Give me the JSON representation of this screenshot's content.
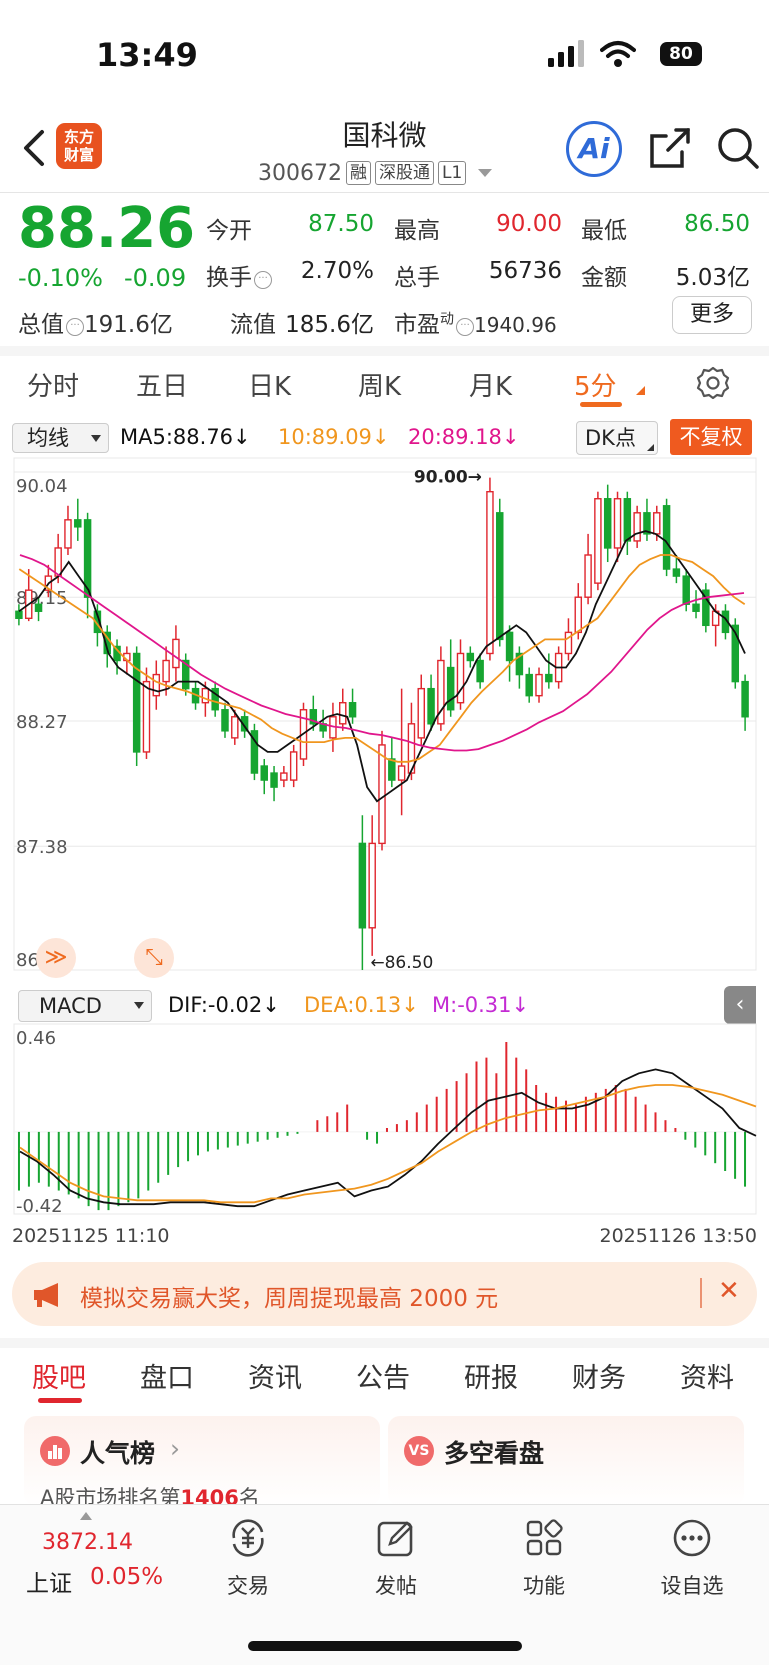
{
  "status": {
    "time": "13:49",
    "battery": "80"
  },
  "header": {
    "logo_line1": "东方",
    "logo_line2": "财富",
    "name": "国科微",
    "code": "300672",
    "tags": [
      "融",
      "深股通",
      "L1"
    ],
    "ai_label": "Ai"
  },
  "quote": {
    "price": "88.26",
    "change_pct": "-0.10%",
    "change": "-0.09",
    "rows": [
      [
        {
          "label": "今开",
          "value": "87.50",
          "color": "green"
        },
        {
          "label": "最高",
          "value": "90.00",
          "color": "red"
        },
        {
          "label": "最低",
          "value": "86.50",
          "color": "green"
        }
      ],
      [
        {
          "label": "换手",
          "value": "2.70%",
          "color": "dark",
          "info": true
        },
        {
          "label": "总手",
          "value": "56736",
          "color": "dark"
        },
        {
          "label": "金额",
          "value": "5.03亿",
          "color": "dark"
        }
      ],
      [
        {
          "label": "总值",
          "value": "191.6亿",
          "color": "dark",
          "info": true
        },
        {
          "label": "流值",
          "value": "185.6亿",
          "color": "dark"
        },
        {
          "label": "市盈",
          "sup": "动",
          "value": "1940.96",
          "color": "dark",
          "info": true
        }
      ]
    ],
    "more_label": "更多"
  },
  "period_tabs": [
    "分时",
    "五日",
    "日K",
    "周K",
    "月K",
    "5分"
  ],
  "active_period": "5分",
  "ma_legend": {
    "selector": "均线",
    "ma5": "MA5:88.76↓",
    "ma10": "10:89.09↓",
    "ma20": "20:89.18↓",
    "dk": "DK点",
    "adjust": "不复权"
  },
  "macd_legend": {
    "selector": "MACD",
    "dif": "DIF:-0.02↓",
    "dea": "DEA:0.13↓",
    "m": "M:-0.31↓"
  },
  "chart_data": {
    "type": "candlestick",
    "price_axis": {
      "ticks": [
        "90.04",
        "89.15",
        "88.27",
        "87.38",
        "86.50"
      ],
      "range": [
        86.5,
        90.04
      ]
    },
    "annotations": {
      "high": "90.00",
      "low": "86.50"
    },
    "candles": [
      {
        "o": 89.05,
        "c": 89.0,
        "h": 89.1,
        "l": 88.95
      },
      {
        "o": 89.0,
        "c": 89.2,
        "h": 89.35,
        "l": 88.98
      },
      {
        "o": 89.1,
        "c": 89.05,
        "h": 89.15,
        "l": 88.98
      },
      {
        "o": 89.2,
        "c": 89.3,
        "h": 89.38,
        "l": 89.15
      },
      {
        "o": 89.3,
        "c": 89.5,
        "h": 89.6,
        "l": 89.25
      },
      {
        "o": 89.5,
        "c": 89.7,
        "h": 89.8,
        "l": 89.45
      },
      {
        "o": 89.7,
        "c": 89.65,
        "h": 89.85,
        "l": 89.55
      },
      {
        "o": 89.7,
        "c": 89.15,
        "h": 89.75,
        "l": 89.0
      },
      {
        "o": 89.05,
        "c": 88.9,
        "h": 89.1,
        "l": 88.8
      },
      {
        "o": 88.9,
        "c": 88.75,
        "h": 88.95,
        "l": 88.65
      },
      {
        "o": 88.8,
        "c": 88.7,
        "h": 88.85,
        "l": 88.6
      },
      {
        "o": 88.7,
        "c": 88.75,
        "h": 88.8,
        "l": 88.6
      },
      {
        "o": 88.75,
        "c": 88.05,
        "h": 88.8,
        "l": 87.95
      },
      {
        "o": 88.05,
        "c": 88.55,
        "h": 88.65,
        "l": 88.0
      },
      {
        "o": 88.45,
        "c": 88.6,
        "h": 88.7,
        "l": 88.35
      },
      {
        "o": 88.55,
        "c": 88.7,
        "h": 88.8,
        "l": 88.45
      },
      {
        "o": 88.65,
        "c": 88.85,
        "h": 88.95,
        "l": 88.55
      },
      {
        "o": 88.7,
        "c": 88.5,
        "h": 88.75,
        "l": 88.45
      },
      {
        "o": 88.5,
        "c": 88.4,
        "h": 88.55,
        "l": 88.35
      },
      {
        "o": 88.4,
        "c": 88.5,
        "h": 88.55,
        "l": 88.3
      },
      {
        "o": 88.5,
        "c": 88.35,
        "h": 88.55,
        "l": 88.3
      },
      {
        "o": 88.35,
        "c": 88.2,
        "h": 88.4,
        "l": 88.15
      },
      {
        "o": 88.15,
        "c": 88.3,
        "h": 88.35,
        "l": 88.1
      },
      {
        "o": 88.3,
        "c": 88.2,
        "h": 88.35,
        "l": 88.15
      },
      {
        "o": 88.2,
        "c": 87.9,
        "h": 88.25,
        "l": 87.85
      },
      {
        "o": 87.95,
        "c": 87.85,
        "h": 88.0,
        "l": 87.75
      },
      {
        "o": 87.9,
        "c": 87.8,
        "h": 87.95,
        "l": 87.7
      },
      {
        "o": 87.85,
        "c": 87.9,
        "h": 87.95,
        "l": 87.8
      },
      {
        "o": 87.85,
        "c": 88.05,
        "h": 88.1,
        "l": 87.8
      },
      {
        "o": 88.0,
        "c": 88.35,
        "h": 88.4,
        "l": 87.95
      },
      {
        "o": 88.35,
        "c": 88.25,
        "h": 88.45,
        "l": 88.2
      },
      {
        "o": 88.25,
        "c": 88.2,
        "h": 88.35,
        "l": 88.15
      },
      {
        "o": 88.15,
        "c": 88.3,
        "h": 88.4,
        "l": 88.05
      },
      {
        "o": 88.25,
        "c": 88.4,
        "h": 88.5,
        "l": 88.2
      },
      {
        "o": 88.4,
        "c": 88.3,
        "h": 88.5,
        "l": 88.25
      },
      {
        "o": 87.4,
        "c": 86.8,
        "h": 87.6,
        "l": 86.5
      },
      {
        "o": 86.8,
        "c": 87.4,
        "h": 87.6,
        "l": 86.6
      },
      {
        "o": 87.4,
        "c": 88.1,
        "h": 88.2,
        "l": 87.35
      },
      {
        "o": 88.0,
        "c": 87.85,
        "h": 88.15,
        "l": 87.8
      },
      {
        "o": 87.85,
        "c": 87.95,
        "h": 88.5,
        "l": 87.6
      },
      {
        "o": 87.9,
        "c": 88.25,
        "h": 88.4,
        "l": 87.85
      },
      {
        "o": 88.15,
        "c": 88.5,
        "h": 88.6,
        "l": 88.1
      },
      {
        "o": 88.5,
        "c": 88.25,
        "h": 88.6,
        "l": 88.2
      },
      {
        "o": 88.25,
        "c": 88.7,
        "h": 88.8,
        "l": 88.2
      },
      {
        "o": 88.65,
        "c": 88.35,
        "h": 88.85,
        "l": 88.3
      },
      {
        "o": 88.4,
        "c": 88.75,
        "h": 88.85,
        "l": 88.35
      },
      {
        "o": 88.75,
        "c": 88.7,
        "h": 88.8,
        "l": 88.65
      },
      {
        "o": 88.7,
        "c": 88.55,
        "h": 88.75,
        "l": 88.5
      },
      {
        "o": 88.75,
        "c": 89.9,
        "h": 90.0,
        "l": 88.7
      },
      {
        "o": 89.75,
        "c": 88.85,
        "h": 89.85,
        "l": 88.8
      },
      {
        "o": 88.9,
        "c": 88.7,
        "h": 88.95,
        "l": 88.55
      },
      {
        "o": 88.75,
        "c": 88.6,
        "h": 88.8,
        "l": 88.5
      },
      {
        "o": 88.6,
        "c": 88.45,
        "h": 88.65,
        "l": 88.4
      },
      {
        "o": 88.45,
        "c": 88.6,
        "h": 88.65,
        "l": 88.4
      },
      {
        "o": 88.6,
        "c": 88.55,
        "h": 88.75,
        "l": 88.5
      },
      {
        "o": 88.55,
        "c": 88.75,
        "h": 88.8,
        "l": 88.5
      },
      {
        "o": 88.75,
        "c": 88.9,
        "h": 89.0,
        "l": 88.7
      },
      {
        "o": 88.9,
        "c": 89.15,
        "h": 89.25,
        "l": 88.85
      },
      {
        "o": 89.15,
        "c": 89.45,
        "h": 89.6,
        "l": 89.1
      },
      {
        "o": 89.25,
        "c": 89.85,
        "h": 89.9,
        "l": 89.2
      },
      {
        "o": 89.85,
        "c": 89.5,
        "h": 89.95,
        "l": 89.4
      },
      {
        "o": 89.5,
        "c": 89.85,
        "h": 89.9,
        "l": 89.4
      },
      {
        "o": 89.85,
        "c": 89.55,
        "h": 89.9,
        "l": 89.45
      },
      {
        "o": 89.55,
        "c": 89.75,
        "h": 89.8,
        "l": 89.5
      },
      {
        "o": 89.75,
        "c": 89.6,
        "h": 89.85,
        "l": 89.55
      },
      {
        "o": 89.6,
        "c": 89.75,
        "h": 89.8,
        "l": 89.55
      },
      {
        "o": 89.8,
        "c": 89.35,
        "h": 89.85,
        "l": 89.3
      },
      {
        "o": 89.35,
        "c": 89.3,
        "h": 89.45,
        "l": 89.25
      },
      {
        "o": 89.3,
        "c": 89.1,
        "h": 89.35,
        "l": 89.05
      },
      {
        "o": 89.1,
        "c": 89.05,
        "h": 89.2,
        "l": 89.0
      },
      {
        "o": 89.2,
        "c": 88.95,
        "h": 89.25,
        "l": 88.9
      },
      {
        "o": 88.95,
        "c": 89.05,
        "h": 89.1,
        "l": 88.8
      },
      {
        "o": 89.05,
        "c": 88.9,
        "h": 89.1,
        "l": 88.85
      },
      {
        "o": 88.95,
        "c": 88.55,
        "h": 89.0,
        "l": 88.5
      },
      {
        "o": 88.55,
        "c": 88.3,
        "h": 88.6,
        "l": 88.2
      }
    ],
    "ma": {
      "ma5": {
        "color": "#111111",
        "values": [
          89.05,
          89.1,
          89.15,
          89.25,
          89.3,
          89.4,
          89.3,
          89.2,
          89.0,
          88.75,
          88.65,
          88.6,
          88.55,
          88.5,
          88.48,
          88.5,
          88.55,
          88.55,
          88.55,
          88.5,
          88.45,
          88.4,
          88.3,
          88.2,
          88.1,
          88.05,
          88.05,
          88.1,
          88.15,
          88.2,
          88.25,
          88.3,
          88.32,
          88.3,
          88.1,
          87.8,
          87.7,
          87.75,
          87.8,
          87.85,
          88.0,
          88.15,
          88.3,
          88.4,
          88.45,
          88.55,
          88.7,
          88.8,
          88.85,
          88.9,
          88.95,
          88.9,
          88.8,
          88.7,
          88.65,
          88.65,
          88.75,
          88.9,
          89.1,
          89.25,
          89.4,
          89.55,
          89.6,
          89.62,
          89.6,
          89.55,
          89.45,
          89.35,
          89.25,
          89.15,
          89.05,
          89.0,
          88.9,
          88.75
        ]
      },
      "ma10": {
        "color": "#f0961e",
        "values": [
          89.35,
          89.3,
          89.25,
          89.2,
          89.15,
          89.1,
          89.05,
          89.0,
          88.9,
          88.8,
          88.72,
          88.65,
          88.6,
          88.55,
          88.52,
          88.5,
          88.48,
          88.45,
          88.42,
          88.4,
          88.38,
          88.36,
          88.32,
          88.28,
          88.22,
          88.18,
          88.15,
          88.12,
          88.12,
          88.12,
          88.14,
          88.15,
          88.15,
          88.1,
          88.05,
          88.0,
          87.98,
          87.98,
          88.0,
          88.05,
          88.1,
          88.2,
          88.3,
          88.4,
          88.48,
          88.55,
          88.62,
          88.7,
          88.75,
          88.8,
          88.85,
          88.85,
          88.85,
          88.9,
          88.95,
          89.0,
          89.1,
          89.2,
          89.3,
          89.38,
          89.42,
          89.45,
          89.45,
          89.42,
          89.4,
          89.35,
          89.3,
          89.22,
          89.15,
          89.1
        ]
      },
      "ma20": {
        "color": "#e0168c",
        "values": [
          89.45,
          89.42,
          89.38,
          89.32,
          89.26,
          89.2,
          89.14,
          89.08,
          89.02,
          88.96,
          88.9,
          88.84,
          88.78,
          88.72,
          88.66,
          88.6,
          88.55,
          88.5,
          88.46,
          88.42,
          88.38,
          88.35,
          88.32,
          88.3,
          88.28,
          88.25,
          88.23,
          88.22,
          88.2,
          88.18,
          88.17,
          88.15,
          88.13,
          88.1,
          88.08,
          88.07,
          88.06,
          88.06,
          88.07,
          88.1,
          88.13,
          88.17,
          88.21,
          88.26,
          88.3,
          88.34,
          88.4,
          88.46,
          88.54,
          88.62,
          88.72,
          88.82,
          88.92,
          89.0,
          89.06,
          89.1,
          89.13,
          89.15,
          89.16,
          89.17,
          89.18
        ]
      }
    },
    "macd": {
      "axis_ticks": [
        "0.46",
        "-0.42"
      ],
      "range": [
        -0.42,
        0.46
      ],
      "hist": [
        -0.3,
        -0.28,
        -0.26,
        -0.28,
        -0.3,
        -0.32,
        -0.34,
        -0.38,
        -0.4,
        -0.4,
        -0.38,
        -0.36,
        -0.34,
        -0.3,
        -0.26,
        -0.22,
        -0.18,
        -0.15,
        -0.12,
        -0.1,
        -0.09,
        -0.08,
        -0.07,
        -0.06,
        -0.05,
        -0.04,
        -0.03,
        -0.02,
        -0.01,
        0.0,
        0.06,
        0.08,
        0.1,
        0.14,
        0.0,
        -0.04,
        -0.06,
        0.02,
        0.04,
        0.06,
        0.1,
        0.14,
        0.18,
        0.22,
        0.26,
        0.3,
        0.36,
        0.38,
        0.3,
        0.46,
        0.38,
        0.32,
        0.24,
        0.2,
        0.18,
        0.16,
        0.14,
        0.18,
        0.2,
        0.22,
        0.24,
        0.22,
        0.18,
        0.14,
        0.1,
        0.06,
        0.02,
        -0.04,
        -0.08,
        -0.12,
        -0.16,
        -0.2,
        -0.24,
        -0.28
      ],
      "dif": [
        -0.1,
        -0.15,
        -0.22,
        -0.3,
        -0.34,
        -0.36,
        -0.37,
        -0.37,
        -0.37,
        -0.36,
        -0.36,
        -0.36,
        -0.37,
        -0.38,
        -0.38,
        -0.35,
        -0.32,
        -0.3,
        -0.28,
        -0.26,
        -0.33,
        -0.3,
        -0.28,
        -0.22,
        -0.15,
        -0.06,
        0.02,
        0.1,
        0.16,
        0.18,
        0.2,
        0.15,
        0.12,
        0.12,
        0.14,
        0.18,
        0.26,
        0.3,
        0.32,
        0.3,
        0.24,
        0.18,
        0.12,
        0.02,
        -0.02
      ],
      "dea": [
        -0.08,
        -0.14,
        -0.2,
        -0.26,
        -0.3,
        -0.33,
        -0.34,
        -0.35,
        -0.35,
        -0.35,
        -0.35,
        -0.35,
        -0.36,
        -0.36,
        -0.36,
        -0.34,
        -0.34,
        -0.32,
        -0.31,
        -0.3,
        -0.29,
        -0.27,
        -0.24,
        -0.2,
        -0.16,
        -0.1,
        -0.05,
        0.0,
        0.04,
        0.07,
        0.09,
        0.11,
        0.12,
        0.14,
        0.16,
        0.18,
        0.21,
        0.23,
        0.24,
        0.24,
        0.23,
        0.21,
        0.19,
        0.16,
        0.13
      ]
    },
    "time_start": "20251125 11:10",
    "time_end": "20251126 13:50"
  },
  "promo": {
    "text": "模拟交易赢大奖，周周提现最高 2000 元"
  },
  "content_tabs": [
    "股吧",
    "盘口",
    "资讯",
    "公告",
    "研报",
    "财务",
    "资料"
  ],
  "cards": {
    "left_title": "人气榜",
    "left_sub_pre": "A股市场排名第",
    "left_rank": "1406",
    "left_sub_post": "名",
    "right_title": "多空看盘",
    "right_badge": "VS"
  },
  "bottom": {
    "index_value": "3872.14",
    "index_name": "上证",
    "index_pct": "0.05%",
    "nav": [
      "交易",
      "发帖",
      "功能",
      "设自选"
    ]
  }
}
